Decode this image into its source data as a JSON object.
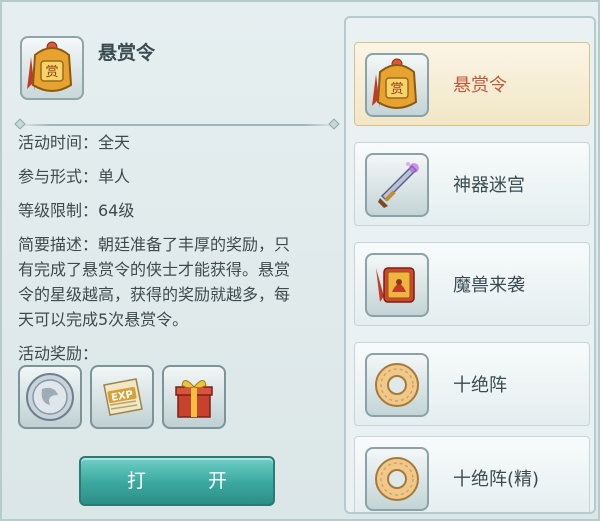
{
  "detail": {
    "title": "悬赏令",
    "icon": "bounty-token-icon",
    "time_label": "活动时间：全天",
    "mode_label": "参与形式：单人",
    "level_label": "等级限制：64级",
    "desc_line1": "简要描述：朝廷准备了丰厚的奖励，只",
    "desc_line2": "有完成了悬赏令的侠士才能获得。悬赏",
    "desc_line3": "令的星级越高，获得的奖励就越多，每",
    "desc_line4": "天可以完成5次悬赏令。",
    "reward_label": "活动奖励：",
    "rewards": [
      {
        "icon": "silver-coin-icon"
      },
      {
        "icon": "exp-scroll-icon"
      },
      {
        "icon": "gift-box-icon"
      }
    ],
    "open_button": "打 开"
  },
  "activity_list": [
    {
      "label": "悬赏令",
      "icon": "bounty-token-icon",
      "selected": true
    },
    {
      "label": "神器迷宫",
      "icon": "divine-sword-icon",
      "selected": false
    },
    {
      "label": "魔兽来袭",
      "icon": "beast-scroll-icon",
      "selected": false
    },
    {
      "label": "十绝阵",
      "icon": "jade-ring-icon",
      "selected": false
    },
    {
      "label": "十绝阵(精)",
      "icon": "jade-ring-icon",
      "selected": false
    }
  ],
  "colors": {
    "accent_selected": "#c25a3a",
    "button": "#3aa89f"
  }
}
